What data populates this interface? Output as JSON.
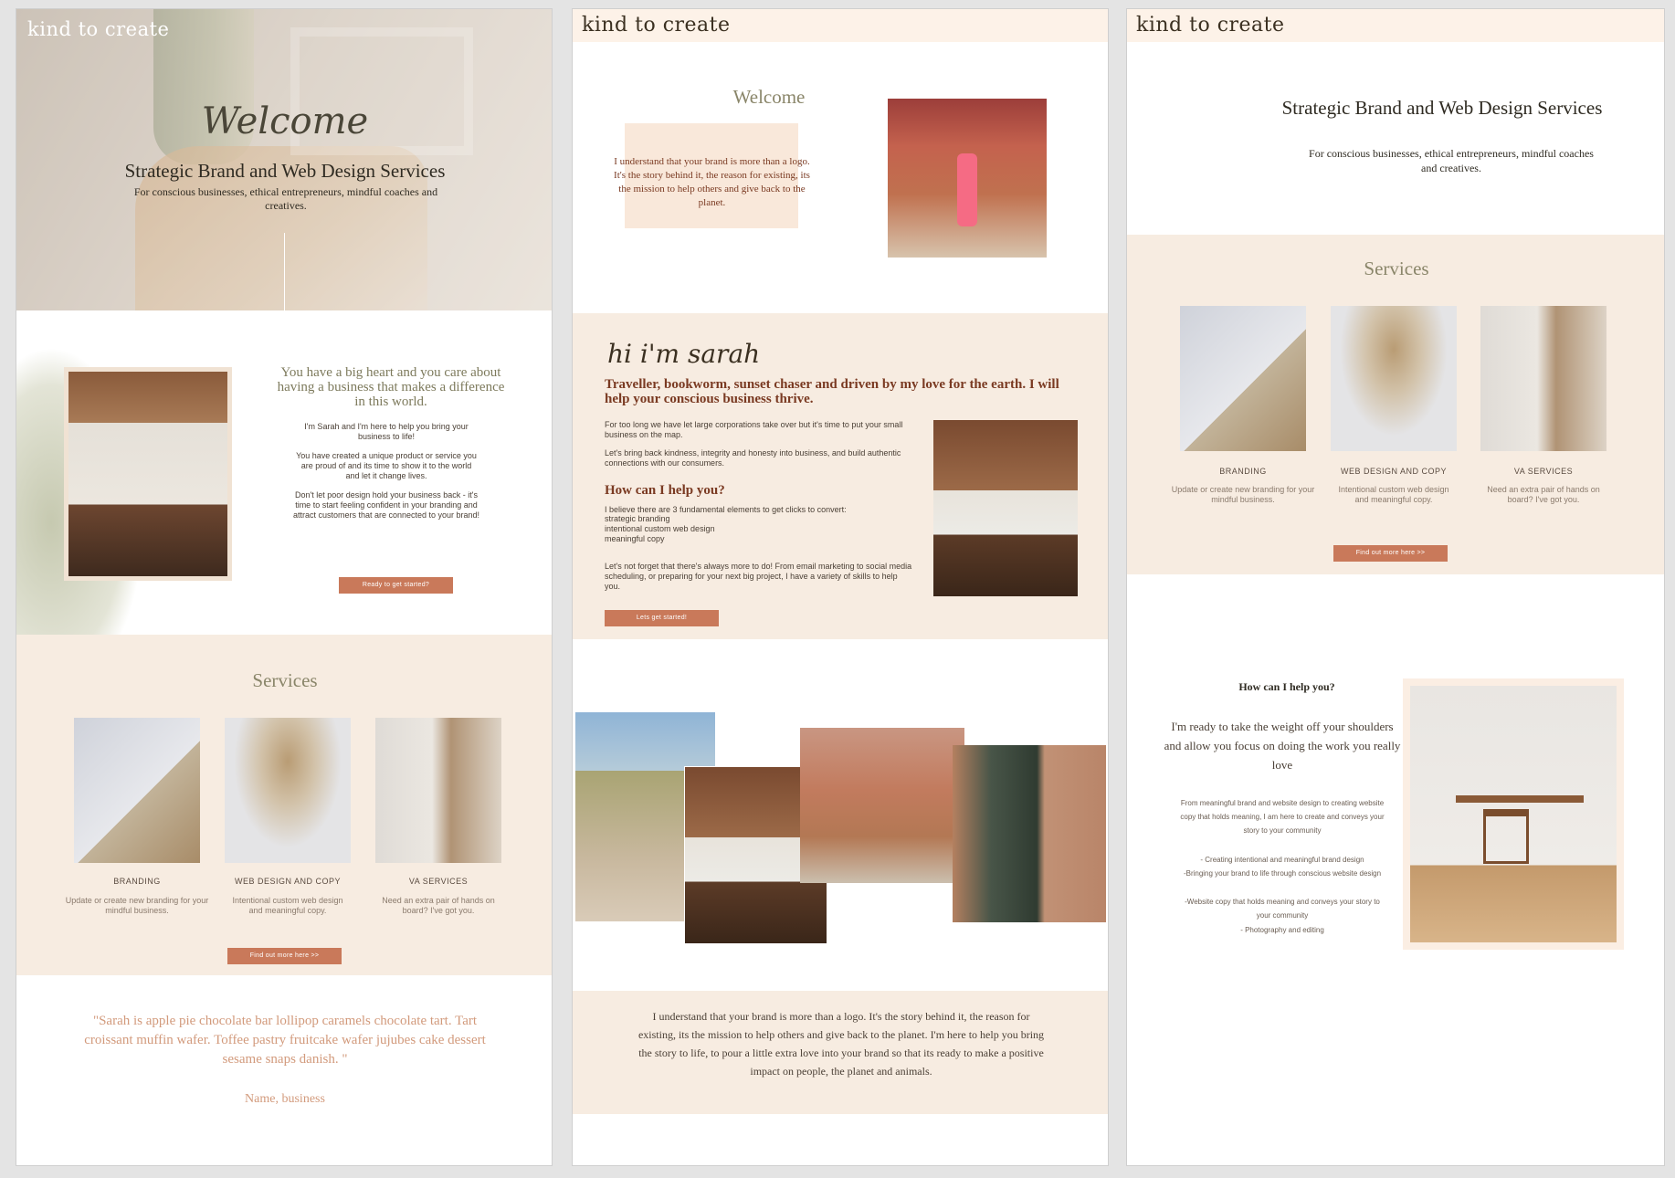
{
  "brand": "kind to create",
  "colors": {
    "accent": "#c9795a",
    "peach": "#f7ece1",
    "olive": "#7d7a5c",
    "rust": "#7a3a22"
  },
  "panel1": {
    "hero_script": "Welcome",
    "hero_title": "Strategic Brand and Web Design Services",
    "hero_sub": "For conscious businesses, ethical entrepreneurs, mindful coaches and creatives.",
    "about_heading": "You have a big heart and you care about having a business that makes a difference in this world.",
    "about_p1": "I'm Sarah and I'm here to help you bring your business to life!",
    "about_p2": "You have created a unique product or service you are proud of and its time to show it to the world and let it change lives.",
    "about_p3": "Don't let poor design hold your business back - it's time to start feeling confident in your branding and attract customers that are connected to your brand!",
    "about_btn": "Ready to get started?",
    "services_title": "Services",
    "services": [
      {
        "title": "BRANDING",
        "text": "Update or create new branding for your mindful business."
      },
      {
        "title": "WEB DESIGN AND COPY",
        "text": "Intentional custom web design and meaningful copy."
      },
      {
        "title": "VA SERVICES",
        "text": "Need an extra pair of hands on board? I've got you."
      }
    ],
    "services_btn": "Find out more here >>",
    "quote": "\"Sarah is apple pie chocolate bar lollipop caramels chocolate tart. Tart croissant muffin wafer. Toffee pastry fruitcake wafer jujubes cake dessert sesame snaps danish. \"",
    "quote_author": "Name, business"
  },
  "panel2": {
    "welcome": "Welcome",
    "welcome_text": "I understand that your brand is more than a logo. It's the story behind it, the reason for existing, its the mission to help others and give back to the planet.",
    "hi_script": "hi i'm sarah",
    "headline": "Traveller, bookworm, sunset chaser and driven by my love for the earth. I will help your conscious business thrive.",
    "p1": "For too long we have let large corporations take over but it's time to put your small business on the map.",
    "p2": "Let's bring back kindness, integrity and honesty into business, and build authentic connections with our consumers.",
    "help_title": "How can I help you?",
    "p3": "I believe there are 3 fundamental elements to get clicks to convert:",
    "list": [
      "strategic branding",
      "intentional custom web design",
      "meaningful copy"
    ],
    "p4": "Let's not forget that there's always more to do! From email marketing to social media scheduling, or preparing for your next big project, I have a variety of skills to help you.",
    "btn": "Lets get started!",
    "bottom_text": "I understand that your brand is more than a logo. It's the story behind it, the reason for existing, its the mission to help others and give back to the planet. I'm here to help you bring the story to life, to pour a little extra love into your brand so that its ready to make a positive impact on people, the planet and animals."
  },
  "panel3": {
    "title": "Strategic Brand and Web Design Services",
    "sub": "For conscious businesses, ethical entrepreneurs, mindful coaches and creatives.",
    "services_title": "Services",
    "services": [
      {
        "title": "BRANDING",
        "text": "Update or create new branding for your mindful business."
      },
      {
        "title": "WEB DESIGN AND COPY",
        "text": "Intentional custom web design and meaningful copy."
      },
      {
        "title": "VA SERVICES",
        "text": "Need an extra pair of hands on board? I've got you."
      }
    ],
    "btn": "Find out more here >>",
    "help_title": "How can I help you?",
    "help_lead": "I'm ready to take the weight off your shoulders and allow you focus on doing the work you really love",
    "help_text": "From meaningful brand and website design to creating website copy that holds meaning, I am here to create and conveys your story to your community",
    "help_list": [
      "- Creating intentional and meaningful brand design",
      "-Bringing your brand to life through conscious website design",
      "-Website copy that holds meaning and conveys your story to your community",
      "- Photography and editing"
    ]
  }
}
